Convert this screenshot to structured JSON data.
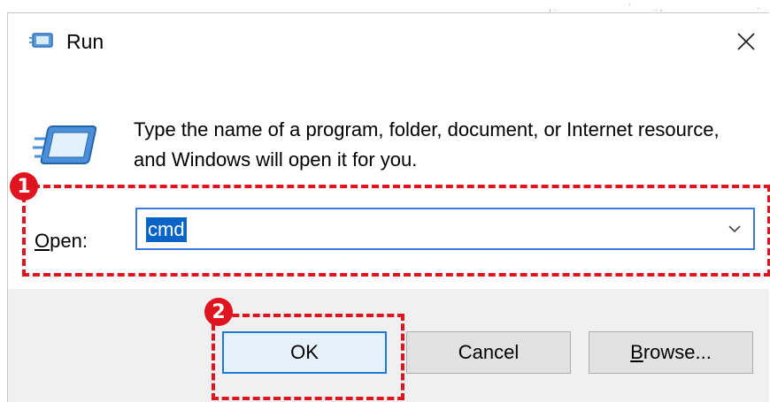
{
  "window": {
    "title": "Run",
    "close_icon": "close-icon"
  },
  "content": {
    "description": "Type the name of a program, folder, document, or Internet resource, and Windows will open it for you.",
    "run_icon": "run-icon"
  },
  "open_field": {
    "label_mnemonic": "O",
    "label_rest": "pen:",
    "value": "cmd",
    "dropdown_icon": "chevron-down-icon"
  },
  "buttons": {
    "ok_label": "OK",
    "cancel_label": "Cancel",
    "browse_mnemonic": "B",
    "browse_rest": "rowse..."
  },
  "annotations": {
    "step1": "1",
    "step2": "2",
    "color": "#e0141e"
  },
  "colors": {
    "accent": "#0a64c8",
    "focus_border": "#3b7ad9",
    "panel": "#f0f0f0"
  }
}
